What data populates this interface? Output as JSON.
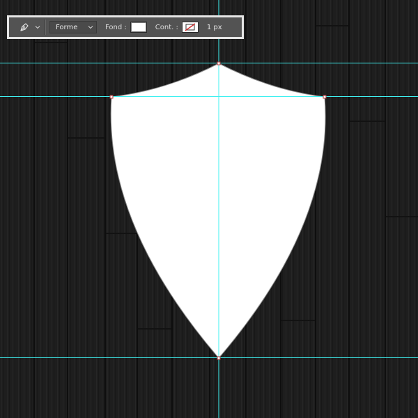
{
  "options_bar": {
    "tool_icon": "pen-tool-icon",
    "mode_value": "Forme",
    "fill_label": "Fond :",
    "fill_color": "#ffffff",
    "stroke_label": "Cont. :",
    "stroke_swatch_icon": "no-stroke-icon",
    "stroke_width": "1 px"
  },
  "canvas": {
    "background": "dark-wood-planks",
    "shape_fill": "#ffffff",
    "guide_color": "#3ff0f0",
    "anchor_color": "#b03a3a"
  }
}
